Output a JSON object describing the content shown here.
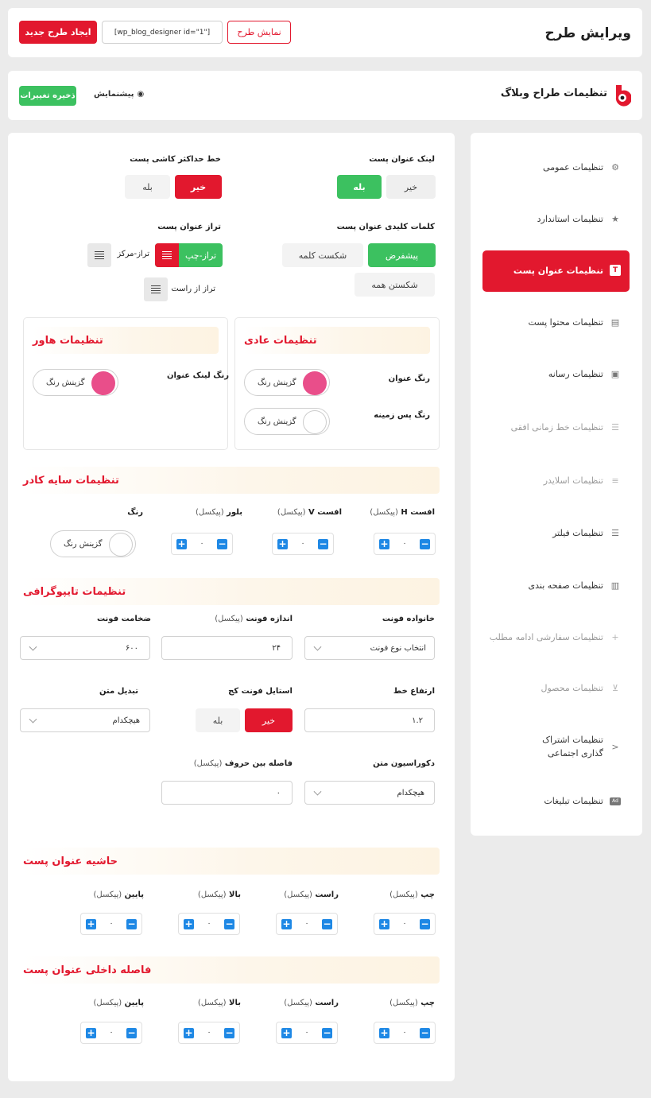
{
  "header": {
    "title": "ویرایش طرح",
    "shortcode": "[wp_blog_designer id=\"1\"]",
    "preview_label": "نمایش طرح",
    "new_label": "ایجاد طرح جدید"
  },
  "subheader": {
    "title": "تنظیمات طراح وبلاگ",
    "preview": "پیشنمایش",
    "save": "ذخیره تغییرات"
  },
  "sidebar": {
    "items": [
      {
        "label": "تنظیمات عمومی",
        "icon": "gear-icon"
      },
      {
        "label": "تنظیمات استاندارد",
        "icon": "star-gear-icon"
      },
      {
        "label": "تنظیمات عنوان پست",
        "icon": "title-icon"
      },
      {
        "label": "تنظیمات محتوا پست",
        "icon": "document-icon"
      },
      {
        "label": "تنظیمات رسانه",
        "icon": "image-icon"
      },
      {
        "label": "تنظیمات خط زمانی افقی",
        "icon": "timeline-icon"
      },
      {
        "label": "تنظیمات اسلایدر",
        "icon": "slider-icon"
      },
      {
        "label": "تنظیمات فیلتر",
        "icon": "filter-icon"
      },
      {
        "label": "تنظیمات صفحه بندی",
        "icon": "book-icon"
      },
      {
        "label": "تنظیمات سفارشی ادامه مطلب",
        "icon": "plus-icon"
      },
      {
        "label": "تنظیمات محصول",
        "icon": "cart-icon"
      },
      {
        "label": "تنظیمات اشتراک گذاری اجتماعی",
        "icon": "share-icon"
      },
      {
        "label": "تنظیمات تبلیغات",
        "icon": "ad-icon"
      }
    ]
  },
  "title_link": {
    "label": "لینک عنوان پست",
    "yes": "بله",
    "no": "خیر"
  },
  "strike": {
    "label": "خط حداکثر کاشی پست",
    "yes": "بله",
    "no": "خیر"
  },
  "keywords": {
    "label": "کلمات کلیدی عنوان پست",
    "default": "پیشفرض",
    "break_word": "شکست کلمه",
    "break_all": "شکستن همه"
  },
  "align": {
    "label": "تراز عنوان پست",
    "left": "تراز-چپ",
    "center": "تراز-مرکز",
    "right": "تراز از راست"
  },
  "normal": {
    "title": "تنظیمات عادی",
    "title_color": "رنگ عنوان",
    "bg_color": "رنگ پس زمینه",
    "pick": "گزینش رنگ"
  },
  "hover": {
    "title": "تنظیمات هاور",
    "link_color": "رنگ لینک عنوان",
    "pick": "گزینش رنگ"
  },
  "shadow": {
    "title": "تنظیمات سایه کادر",
    "h": "افست H",
    "v": "افست V",
    "blur": "بلور",
    "color": "رنگ",
    "unit": "(پیکسل)",
    "h_val": "۰",
    "v_val": "۰",
    "blur_val": "۰",
    "pick": "گزینش رنگ"
  },
  "typo": {
    "title": "تنظیمات تایپوگرافی",
    "family": "خانواده فونت",
    "family_val": "انتخاب نوع فونت",
    "size": "اندازه فونت",
    "size_val": "۲۴",
    "weight": "ضخامت فونت",
    "weight_val": "۶۰۰",
    "line_height": "ارتفاع خط",
    "line_height_val": "۱.۲",
    "italic": "استایل فونت کج",
    "yes": "بله",
    "no": "خیر",
    "transform": "تبدیل متن",
    "transform_val": "هیچکدام",
    "decoration": "دکوراسیون متن",
    "decoration_val": "هیچکدام",
    "spacing": "فاصله بین حروف",
    "spacing_val": "۰",
    "unit": "(پیکسل)"
  },
  "margin": {
    "title": "حاشیه عنوان پست",
    "left": "چپ",
    "right": "راست",
    "top": "بالا",
    "bottom": "پایین",
    "unit": "(پیکسل)",
    "val": "۰"
  },
  "padding": {
    "title": "فاصله داخلی عنوان پست",
    "left": "چپ",
    "right": "راست",
    "top": "بالا",
    "bottom": "پایین",
    "unit": "(پیکسل)",
    "val": "۰"
  },
  "colors": {
    "accent": "#e2182e",
    "green": "#3cc160",
    "blue": "#1e88e5",
    "pink": "#e94e8a"
  }
}
